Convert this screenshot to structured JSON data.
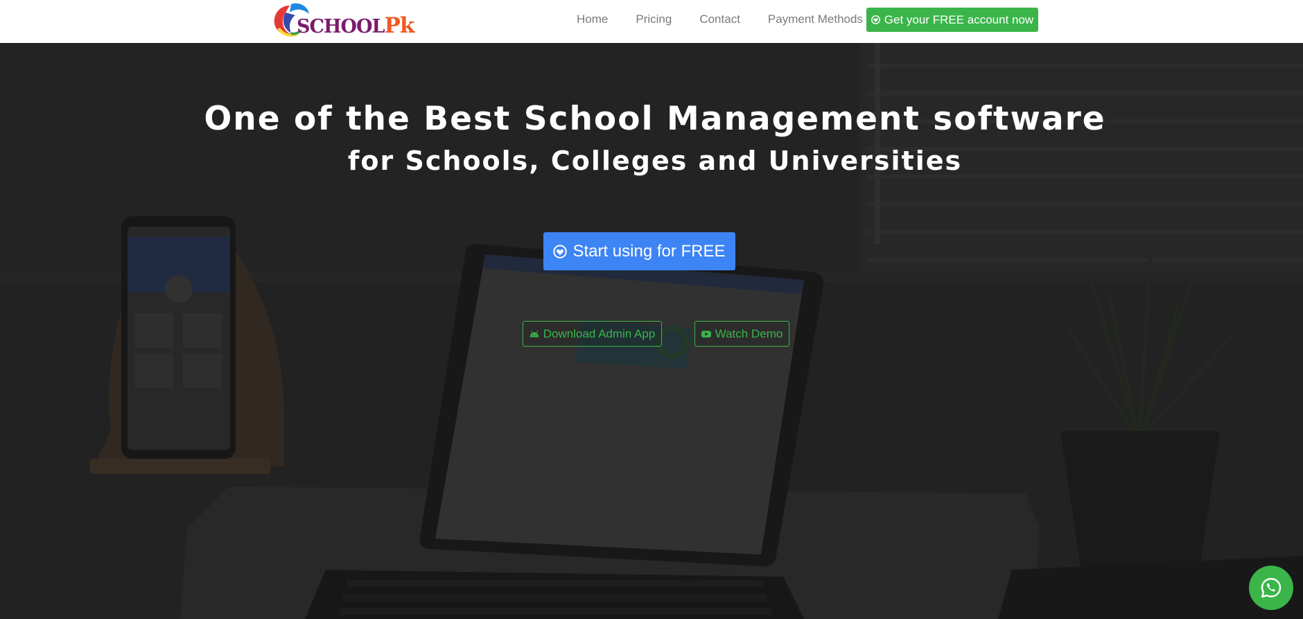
{
  "brand": {
    "logo_text_main": "SCHOOL",
    "logo_text_accent": "Pk"
  },
  "nav": {
    "items": [
      {
        "label": "Home"
      },
      {
        "label": "Pricing"
      },
      {
        "label": "Contact"
      },
      {
        "label": "Payment Methods"
      }
    ],
    "cta_label": "Get your FREE account now",
    "cta_icon": "heart-circle-icon"
  },
  "hero": {
    "title": "One of the Best School Management software",
    "subtitle": "for Schools, Colleges and Universities",
    "start_button_label": "Start using for FREE",
    "start_button_icon": "heart-circle-icon",
    "download_app_label": "Download Admin App",
    "download_app_icon": "android-icon",
    "watch_demo_label": "Watch Demo",
    "watch_demo_icon": "youtube-icon"
  },
  "floating": {
    "whatsapp_icon": "whatsapp-icon"
  },
  "colors": {
    "primary_blue": "#3d84f5",
    "accent_green": "#3bb54a",
    "nav_text": "#7a7a7a",
    "logo_purple": "#7b1b6e",
    "logo_orange": "#f05a22"
  }
}
